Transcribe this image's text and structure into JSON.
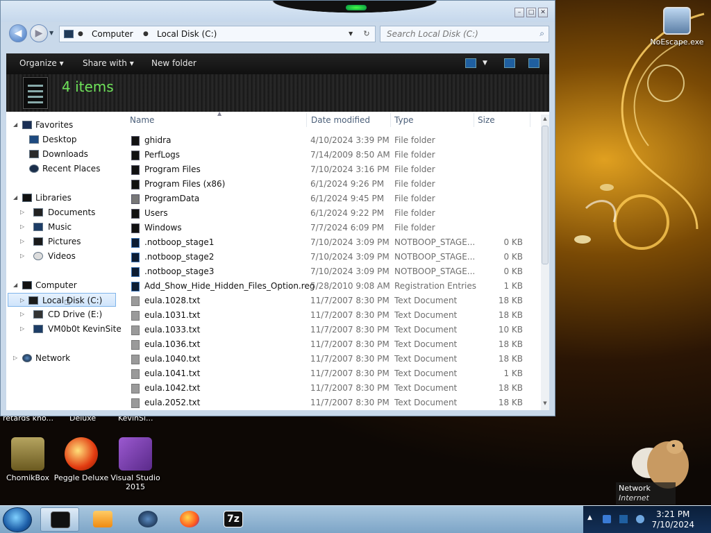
{
  "window": {
    "address": {
      "crumb1": "Computer",
      "crumb2": "Local Disk (C:)"
    },
    "search_placeholder": "Search Local Disk (C:)",
    "toolbar": {
      "organize": "Organize",
      "share": "Share with",
      "new_folder": "New folder"
    },
    "banner": {
      "count": "4 items"
    },
    "nav": {
      "favorites": "Favorites",
      "desktop": "Desktop",
      "downloads": "Downloads",
      "recent": "Recent Places",
      "libraries": "Libraries",
      "documents": "Documents",
      "music": "Music",
      "pictures": "Pictures",
      "videos": "Videos",
      "computer": "Computer",
      "local_disk": "Local Disk (C:)",
      "cd_drive": "CD Drive (E:)",
      "vm_drive": "VM0b0t KevinSite",
      "network": "Network"
    },
    "columns": {
      "name": "Name",
      "date": "Date modified",
      "type": "Type",
      "size": "Size"
    },
    "files": [
      {
        "name": "ghidra",
        "date": "4/10/2024 3:39 PM",
        "type": "File folder",
        "size": "",
        "icon": "folder"
      },
      {
        "name": "PerfLogs",
        "date": "7/14/2009 8:50 AM",
        "type": "File folder",
        "size": "",
        "icon": "folder"
      },
      {
        "name": "Program Files",
        "date": "7/10/2024 3:16 PM",
        "type": "File folder",
        "size": "",
        "icon": "folder"
      },
      {
        "name": "Program Files (x86)",
        "date": "6/1/2024 9:26 PM",
        "type": "File folder",
        "size": "",
        "icon": "folder"
      },
      {
        "name": "ProgramData",
        "date": "6/1/2024 9:45 PM",
        "type": "File folder",
        "size": "",
        "icon": "folder-gray"
      },
      {
        "name": "Users",
        "date": "6/1/2024 9:22 PM",
        "type": "File folder",
        "size": "",
        "icon": "folder"
      },
      {
        "name": "Windows",
        "date": "7/7/2024 6:09 PM",
        "type": "File folder",
        "size": "",
        "icon": "folder"
      },
      {
        "name": ".notboop_stage1",
        "date": "7/10/2024 3:09 PM",
        "type": "NOTBOOP_STAGE...",
        "size": "0 KB",
        "icon": "file-blue"
      },
      {
        "name": ".notboop_stage2",
        "date": "7/10/2024 3:09 PM",
        "type": "NOTBOOP_STAGE...",
        "size": "0 KB",
        "icon": "file-blue"
      },
      {
        "name": ".notboop_stage3",
        "date": "7/10/2024 3:09 PM",
        "type": "NOTBOOP_STAGE...",
        "size": "0 KB",
        "icon": "file-blue"
      },
      {
        "name": "Add_Show_Hide_Hidden_Files_Option.reg",
        "date": "5/28/2010 9:08 AM",
        "type": "Registration Entries",
        "size": "1 KB",
        "icon": "file-blue"
      },
      {
        "name": "eula.1028.txt",
        "date": "11/7/2007 8:30 PM",
        "type": "Text Document",
        "size": "18 KB",
        "icon": "text"
      },
      {
        "name": "eula.1031.txt",
        "date": "11/7/2007 8:30 PM",
        "type": "Text Document",
        "size": "18 KB",
        "icon": "text"
      },
      {
        "name": "eula.1033.txt",
        "date": "11/7/2007 8:30 PM",
        "type": "Text Document",
        "size": "10 KB",
        "icon": "text"
      },
      {
        "name": "eula.1036.txt",
        "date": "11/7/2007 8:30 PM",
        "type": "Text Document",
        "size": "18 KB",
        "icon": "text"
      },
      {
        "name": "eula.1040.txt",
        "date": "11/7/2007 8:30 PM",
        "type": "Text Document",
        "size": "18 KB",
        "icon": "text"
      },
      {
        "name": "eula.1041.txt",
        "date": "11/7/2007 8:30 PM",
        "type": "Text Document",
        "size": "1 KB",
        "icon": "text"
      },
      {
        "name": "eula.1042.txt",
        "date": "11/7/2007 8:30 PM",
        "type": "Text Document",
        "size": "18 KB",
        "icon": "text"
      },
      {
        "name": "eula.2052.txt",
        "date": "11/7/2007 8:30 PM",
        "type": "Text Document",
        "size": "18 KB",
        "icon": "text"
      }
    ]
  },
  "desktop": {
    "noescape": "NoEscape.exe",
    "partial1": "retards kno...",
    "partial2": "Deluxe",
    "partial3": "KevinSi...",
    "chomikbox": "ChomikBox",
    "peggle": "Peggle Deluxe",
    "vstudio": "Visual Studio 2015",
    "network_title": "Network",
    "network_sub": "Internet access"
  },
  "taskbar": {
    "time": "3:21 PM",
    "date": "7/10/2024"
  },
  "colors": {
    "banner_text": "#6fe35a",
    "selection": "#cfe4fb"
  }
}
